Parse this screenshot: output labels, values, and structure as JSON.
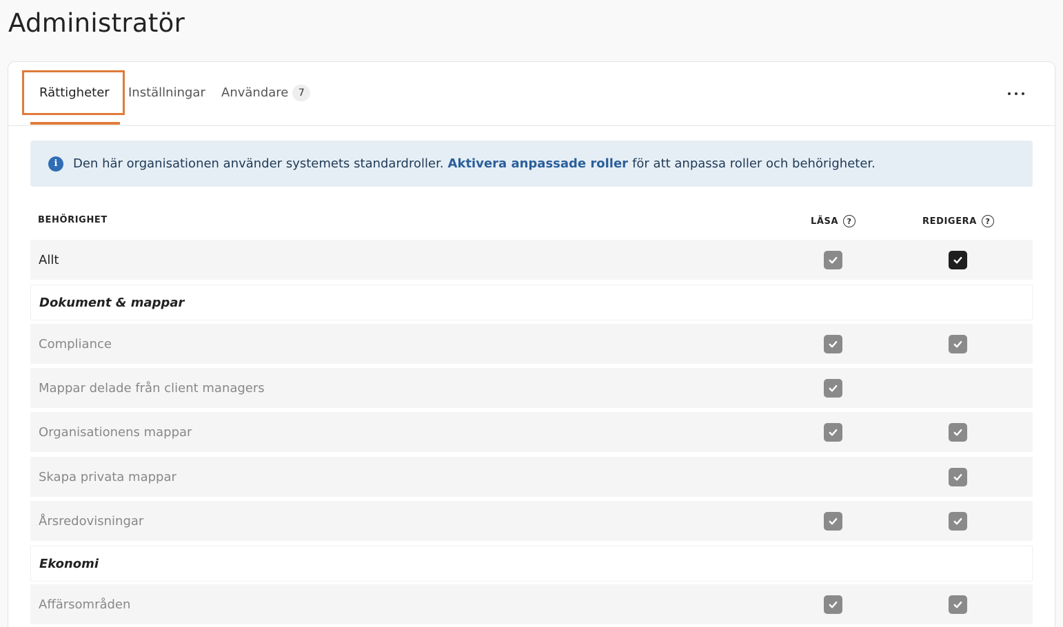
{
  "page": {
    "title": "Administratör"
  },
  "tabs": [
    {
      "label": "Rättigheter",
      "active": true
    },
    {
      "label": "Inställningar",
      "active": false
    },
    {
      "label": "Användare",
      "badge": "7",
      "active": false
    }
  ],
  "info_banner": {
    "text_before": "Den här organisationen använder systemets standardroller.",
    "link": "Aktivera anpassade roller",
    "text_after": "för att anpassa roller och behörigheter."
  },
  "table": {
    "columns": {
      "permission": "BEHÖRIGHET",
      "read": "LÄSA",
      "edit": "REDIGERA"
    },
    "rows": [
      {
        "label": "Allt",
        "type": "primary",
        "read": true,
        "edit": true
      },
      {
        "label": "Dokument & mappar",
        "type": "section"
      },
      {
        "label": "Compliance",
        "type": "item",
        "read": true,
        "edit": true
      },
      {
        "label": "Mappar delade från client managers",
        "type": "item",
        "read": true,
        "edit": false
      },
      {
        "label": "Organisationens mappar",
        "type": "item",
        "read": true,
        "edit": true
      },
      {
        "label": "Skapa privata mappar",
        "type": "item",
        "read": false,
        "edit": true
      },
      {
        "label": "Årsredovisningar",
        "type": "item",
        "read": true,
        "edit": true
      },
      {
        "label": "Ekonomi",
        "type": "section"
      },
      {
        "label": "Affärsområden",
        "type": "item",
        "read": true,
        "edit": true
      }
    ]
  },
  "colors": {
    "accent": "#e07b39",
    "info_bg": "#e6eef5",
    "link": "#2a5f9a",
    "checkbox_checked_enabled": "#1f1f1f",
    "checkbox_checked_disabled": "#8a8a8a"
  }
}
